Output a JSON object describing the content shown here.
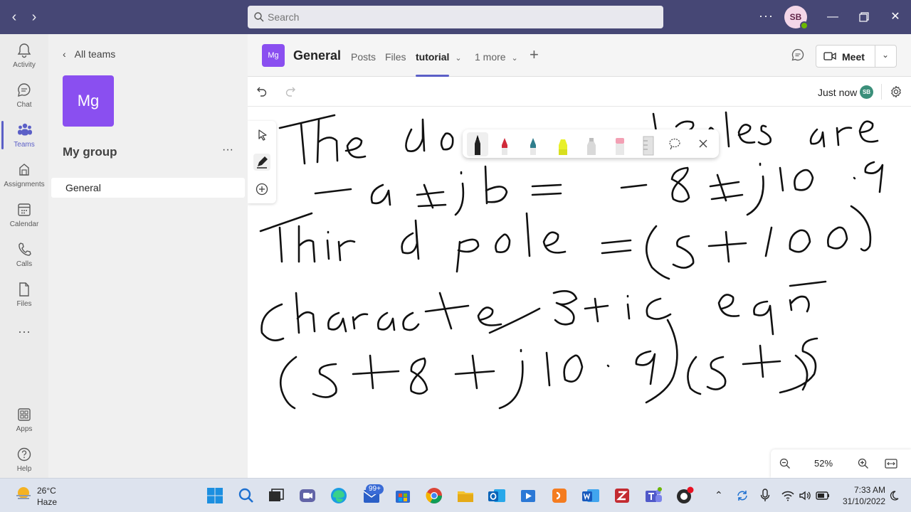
{
  "titlebar": {
    "search_placeholder": "Search",
    "user_initials": "SB",
    "more_label": "···"
  },
  "rail": {
    "items": [
      {
        "label": "Activity",
        "icon": "bell-icon"
      },
      {
        "label": "Chat",
        "icon": "chat-icon"
      },
      {
        "label": "Teams",
        "icon": "teams-icon",
        "active": true
      },
      {
        "label": "Assignments",
        "icon": "assignments-icon"
      },
      {
        "label": "Calendar",
        "icon": "calendar-icon"
      },
      {
        "label": "Calls",
        "icon": "phone-icon"
      },
      {
        "label": "Files",
        "icon": "file-icon"
      }
    ],
    "more": "···",
    "bottom": [
      {
        "label": "Apps",
        "icon": "apps-icon"
      },
      {
        "label": "Help",
        "icon": "help-icon"
      }
    ]
  },
  "panel": {
    "back_label": "All teams",
    "team_initials": "Mg",
    "team_name": "My group",
    "team_more": "···",
    "channels": [
      "General"
    ]
  },
  "channel_header": {
    "icon_initials": "Mg",
    "title": "General",
    "tabs": [
      "Posts",
      "Files",
      "tutorial",
      "1 more"
    ],
    "active_tab": "tutorial",
    "meet_label": "Meet"
  },
  "whiteboard": {
    "status": "Just now",
    "status_initials": "SB",
    "zoom": "52%",
    "handwriting": [
      "The do… poles are",
      "−a ± jb = −8 ± j10.9",
      "Third pole = (s+100)",
      "Characteristic eqn",
      "(s+8+j10.9)(s+8"
    ]
  },
  "taskbar": {
    "temperature": "26°C",
    "condition": "Haze",
    "badge": "99+",
    "time": "7:33 AM",
    "date": "31/10/2022"
  },
  "colors": {
    "titlebar": "#464775",
    "accent": "#5b5fc7",
    "team_tile": "#8a4ff0"
  }
}
